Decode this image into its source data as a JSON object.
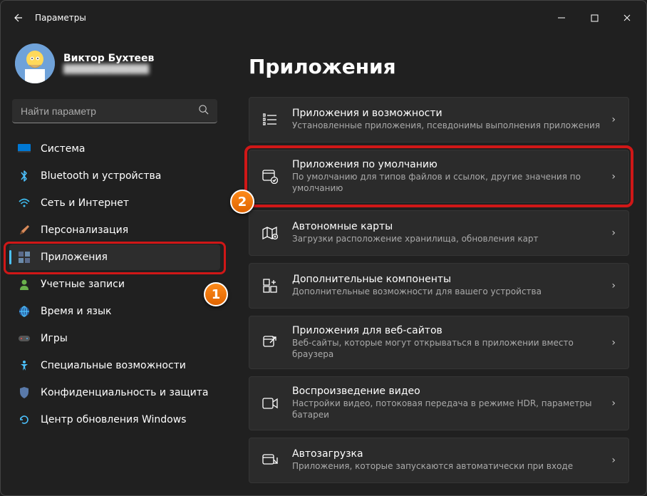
{
  "window": {
    "title": "Параметры"
  },
  "profile": {
    "name": "Виктор Бухтеев",
    "email": "█████████████"
  },
  "search": {
    "placeholder": "Найти параметр"
  },
  "sidebar": {
    "items": [
      {
        "label": "Система"
      },
      {
        "label": "Bluetooth и устройства"
      },
      {
        "label": "Сеть и Интернет"
      },
      {
        "label": "Персонализация"
      },
      {
        "label": "Приложения"
      },
      {
        "label": "Учетные записи"
      },
      {
        "label": "Время и язык"
      },
      {
        "label": "Игры"
      },
      {
        "label": "Специальные возможности"
      },
      {
        "label": "Конфиденциальность и защита"
      },
      {
        "label": "Центр обновления Windows"
      }
    ],
    "activeIndex": 4
  },
  "main": {
    "title": "Приложения",
    "cards": [
      {
        "title": "Приложения и возможности",
        "sub": "Установленные приложения, псевдонимы выполнения приложения"
      },
      {
        "title": "Приложения по умолчанию",
        "sub": "По умолчанию для типов файлов и ссылок, другие значения по умолчанию"
      },
      {
        "title": "Автономные карты",
        "sub": "Загрузки расположение хранилища, обновления карт"
      },
      {
        "title": "Дополнительные компоненты",
        "sub": "Дополнительные возможности для вашего устройства"
      },
      {
        "title": "Приложения для веб-сайтов",
        "sub": "Веб-сайты, которые могут открываться в приложении вместо браузера"
      },
      {
        "title": "Воспроизведение видео",
        "sub": "Настройки видео, потоковая передача в режиме HDR, параметры батареи"
      },
      {
        "title": "Автозагрузка",
        "sub": "Приложения, которые запускаются автоматически при входе"
      }
    ],
    "highlightedCardIndex": 1
  },
  "markers": {
    "one": "1",
    "two": "2"
  }
}
